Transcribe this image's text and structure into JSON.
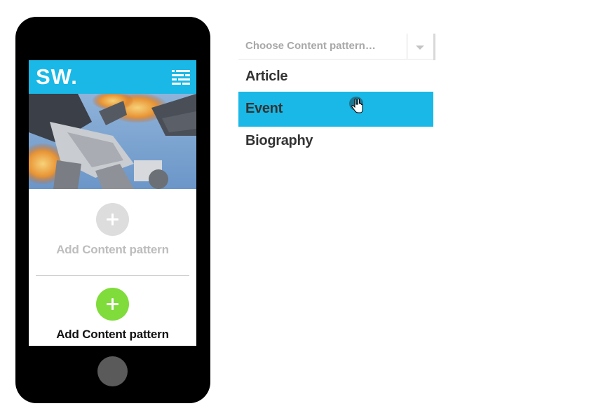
{
  "phone": {
    "header": {
      "logo": "SW.",
      "brand_color": "#19b8e6",
      "menu_icon": "menu-icon"
    },
    "hero": {
      "icon": "hero-illustration"
    },
    "add_blocks": [
      {
        "label": "Add Content pattern",
        "icon": "plus-icon",
        "state": "disabled",
        "color": "#dddddd"
      },
      {
        "label": "Add Content pattern",
        "icon": "plus-icon",
        "state": "active",
        "color": "#7fdc3a"
      }
    ],
    "home_button": {
      "icon": "home-button"
    }
  },
  "dropdown": {
    "placeholder": "Choose Content pattern…",
    "arrow_icon": "chevron-down-icon",
    "options": [
      {
        "label": "Article",
        "selected": false
      },
      {
        "label": "Event",
        "selected": true
      },
      {
        "label": "Biography",
        "selected": false
      }
    ],
    "highlight_color": "#19b8e6"
  },
  "cursor": {
    "icon": "hand-pointer-icon"
  }
}
